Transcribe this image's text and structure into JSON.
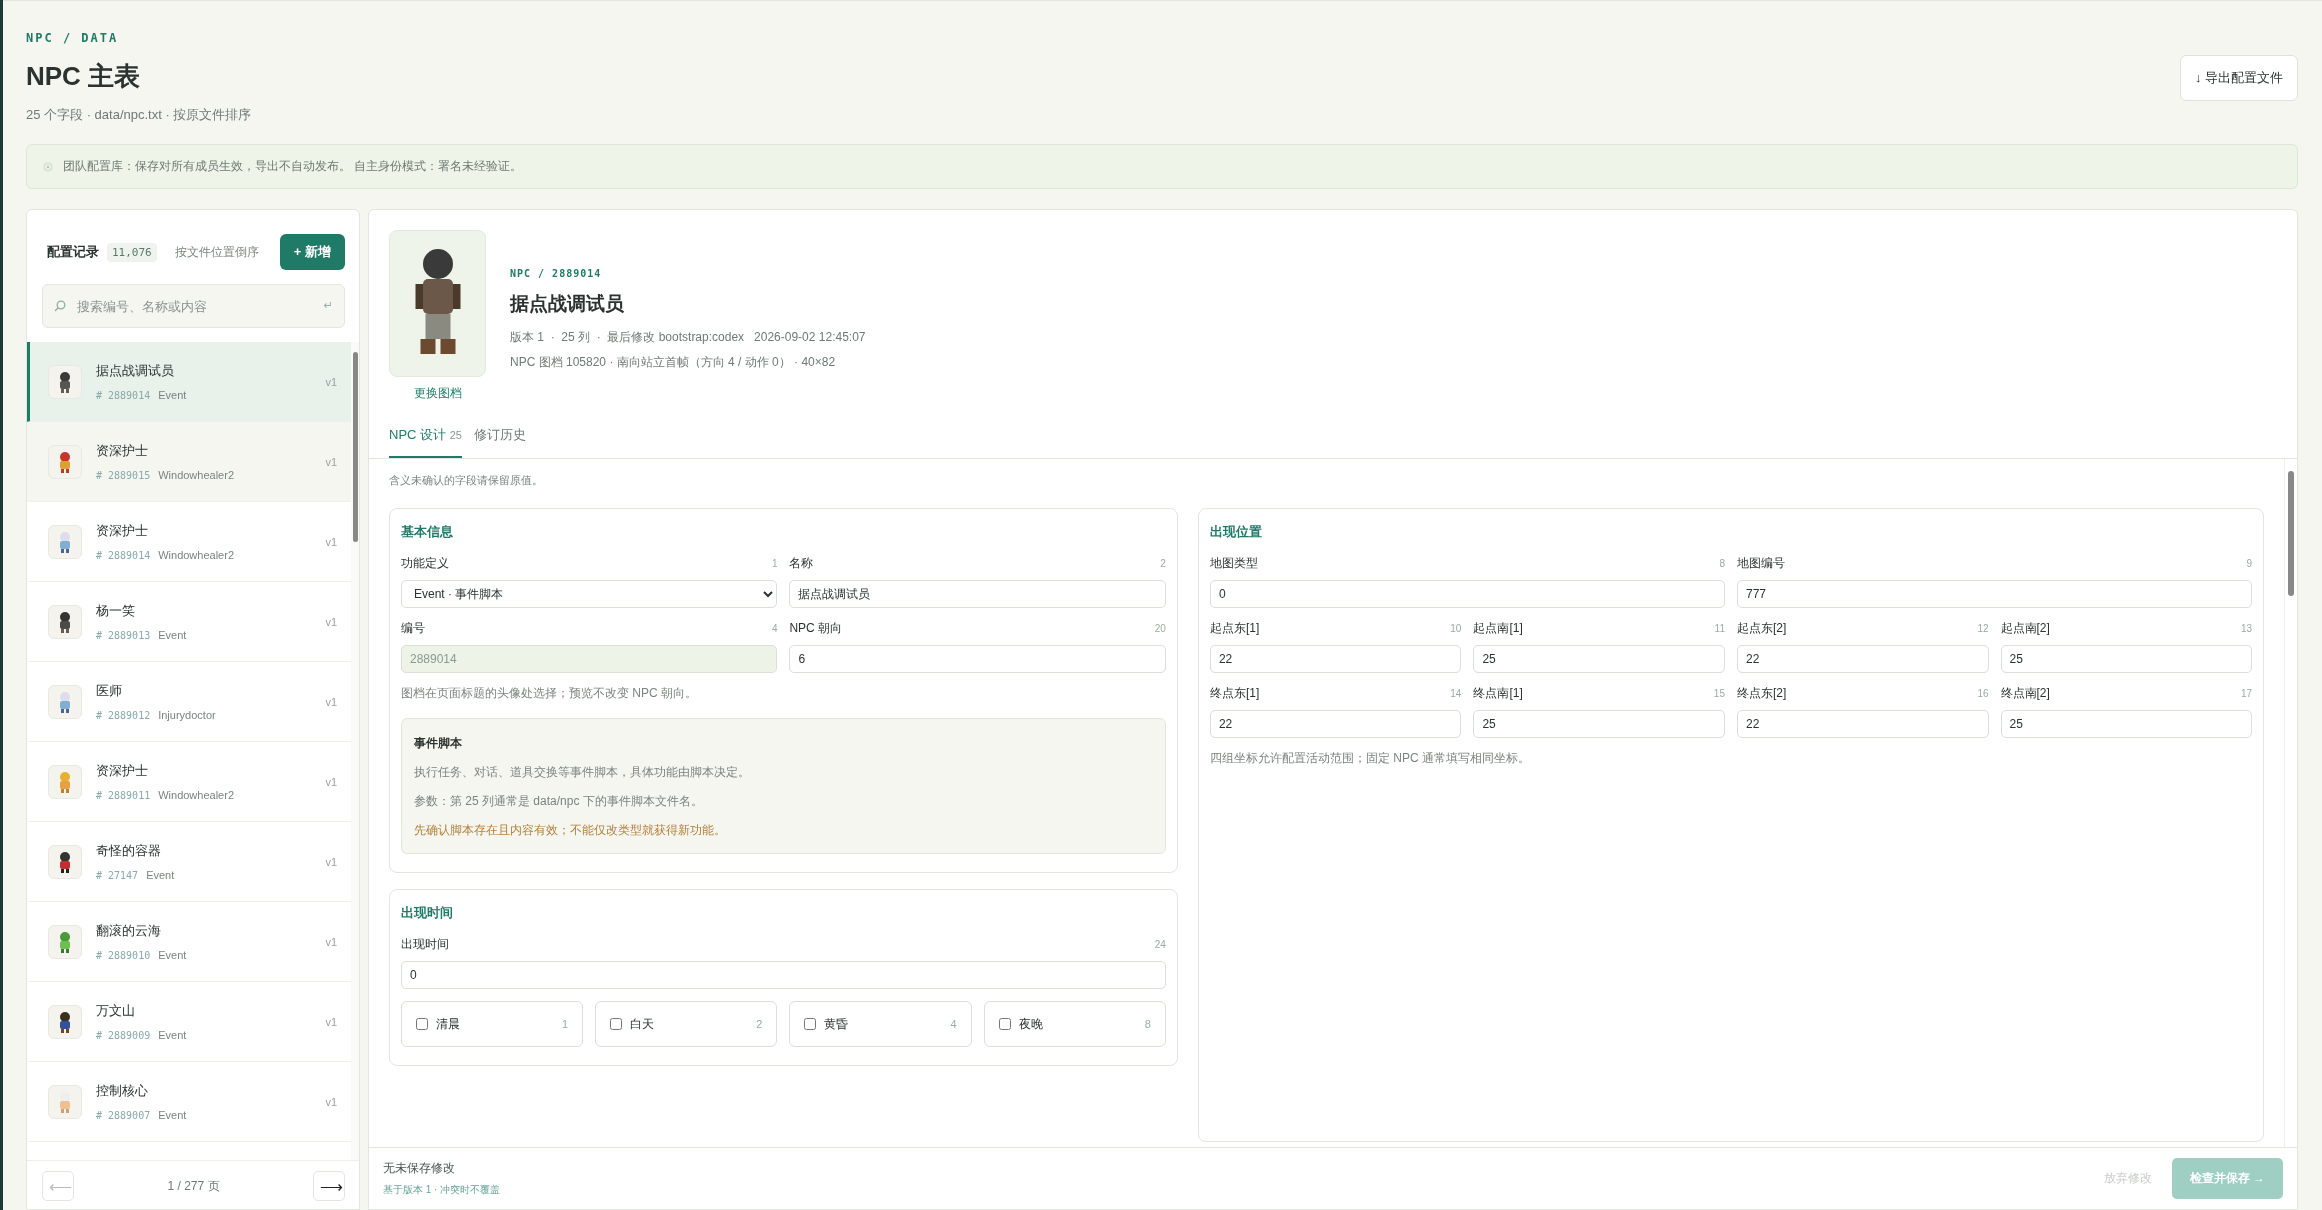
{
  "breadcrumb": "NPC / DATA",
  "title": "NPC 主表",
  "subtitle": "25 个字段 · data/npc.txt · 按原文件排序",
  "export_button": "↓ 导出配置文件",
  "notice": "团队配置库：保存对所有成员生效，导出不自动发布。 自主身份模式：署名未经验证。",
  "sidebar": {
    "title": "配置记录",
    "count": "11,076",
    "sort": "按文件位置倒序",
    "new_button": "+ 新增",
    "search": {
      "placeholder": "搜索编号、名称或内容",
      "hint": "↵"
    },
    "items": [
      {
        "name": "据点战调试员",
        "id": "# 2889014",
        "type": "Event",
        "version": "v1",
        "selected": true,
        "hovered": false
      },
      {
        "name": "资深护士",
        "id": "# 2889015",
        "type": "Windowhealer2",
        "version": "v1",
        "selected": false,
        "hovered": true
      },
      {
        "name": "资深护士",
        "id": "# 2889014",
        "type": "Windowhealer2",
        "version": "v1",
        "selected": false,
        "hovered": false
      },
      {
        "name": "杨一笑",
        "id": "# 2889013",
        "type": "Event",
        "version": "v1",
        "selected": false,
        "hovered": false
      },
      {
        "name": "医师",
        "id": "# 2889012",
        "type": "Injurydoctor",
        "version": "v1",
        "selected": false,
        "hovered": false
      },
      {
        "name": "资深护士",
        "id": "# 2889011",
        "type": "Windowhealer2",
        "version": "v1",
        "selected": false,
        "hovered": false
      },
      {
        "name": "奇怪的容器",
        "id": "# 27147",
        "type": "Event",
        "version": "v1",
        "selected": false,
        "hovered": false
      },
      {
        "name": "翻滚的云海",
        "id": "# 2889010",
        "type": "Event",
        "version": "v1",
        "selected": false,
        "hovered": false
      },
      {
        "name": "万文山",
        "id": "# 2889009",
        "type": "Event",
        "version": "v1",
        "selected": false,
        "hovered": false
      },
      {
        "name": "控制核心",
        "id": "# 2889007",
        "type": "Event",
        "version": "v1",
        "selected": false,
        "hovered": false
      }
    ],
    "pager": {
      "prev": {
        "label": "⟵",
        "disabled": true
      },
      "page": "1 / 277 页",
      "next": {
        "label": "⟶",
        "disabled": false
      }
    }
  },
  "detail": {
    "path": "NPC / 2889014",
    "name": "据点战调试员",
    "meta": "版本 1  ·  25 列  ·  最后修改 bootstrap:codex   2026-09-02 12:45:07",
    "sprite_info": "NPC 图档 105820 · 南向站立首帧（方向 4 / 动作 0） · 40×82",
    "change_sprite": "更换图档",
    "tabs": [
      {
        "label": "NPC 设计",
        "count": "25",
        "selected": true
      },
      {
        "label": "修订历史",
        "selected": false
      }
    ],
    "hint": "含义未确认的字段请保留原值。",
    "columns": [
      [
        {
          "title": "基本信息",
          "rows": [
            [
              {
                "label": "功能定义",
                "index": "1",
                "value": "Event · 事件脚本",
                "kind": "select"
              },
              {
                "label": "名称",
                "index": "2",
                "value": "据点战调试员",
                "kind": "input"
              }
            ],
            [
              {
                "label": "编号",
                "index": "4",
                "value": "2889014",
                "kind": "readonly"
              },
              {
                "label": "NPC 朝向",
                "index": "20",
                "value": "6",
                "kind": "input"
              }
            ]
          ],
          "note": "图档在页面标题的头像处选择；预览不改变 NPC 朝向。",
          "info_box": {
            "title": "事件脚本",
            "lines": [
              {
                "text": "执行任务、对话、道具交换等事件脚本，具体功能由脚本决定。",
                "kind": "normal"
              },
              {
                "text": "参数：第 25 列通常是 data/npc 下的事件脚本文件名。",
                "kind": "normal"
              },
              {
                "text": "先确认脚本存在且内容有效；不能仅改类型就获得新功能。",
                "kind": "warning"
              }
            ]
          }
        },
        {
          "title": "出现时间",
          "rows": [
            [
              {
                "label": "出现时间",
                "index": "24",
                "value": "0",
                "kind": "input"
              }
            ]
          ],
          "flags": [
            {
              "label": "清晨",
              "value": "1",
              "checked": false
            },
            {
              "label": "白天",
              "value": "2",
              "checked": false
            },
            {
              "label": "黄昏",
              "value": "4",
              "checked": false
            },
            {
              "label": "夜晚",
              "value": "8",
              "checked": false
            }
          ]
        }
      ],
      [
        {
          "title": "出现位置",
          "map_fields": [
            {
              "label": "地图类型",
              "index": "8",
              "value": "0",
              "kind": "input"
            },
            {
              "label": "地图编号",
              "index": "9",
              "value": "777",
              "kind": "input"
            }
          ],
          "coordinates": [
            [
              {
                "label": "起点东[1]",
                "index": "10",
                "value": "22",
                "kind": "input"
              },
              {
                "label": "起点南[1]",
                "index": "11",
                "value": "25",
                "kind": "input"
              },
              {
                "label": "起点东[2]",
                "index": "12",
                "value": "22",
                "kind": "input"
              },
              {
                "label": "起点南[2]",
                "index": "13",
                "value": "25",
                "kind": "input"
              }
            ],
            [
              {
                "label": "终点东[1]",
                "index": "14",
                "value": "22",
                "kind": "input"
              },
              {
                "label": "终点南[1]",
                "index": "15",
                "value": "25",
                "kind": "input"
              },
              {
                "label": "终点东[2]",
                "index": "16",
                "value": "22",
                "kind": "input"
              },
              {
                "label": "终点南[2]",
                "index": "17",
                "value": "25",
                "kind": "input"
              }
            ]
          ],
          "note": "四组坐标允许配置活动范围；固定 NPC 通常填写相同坐标。"
        }
      ]
    ],
    "footer": {
      "status": "无未保存修改",
      "base": "基于版本 1 · 冲突时不覆盖",
      "discard": {
        "label": "放弃修改",
        "disabled": true
      },
      "save": {
        "label": "检查并保存 →",
        "disabled": true
      }
    }
  }
}
